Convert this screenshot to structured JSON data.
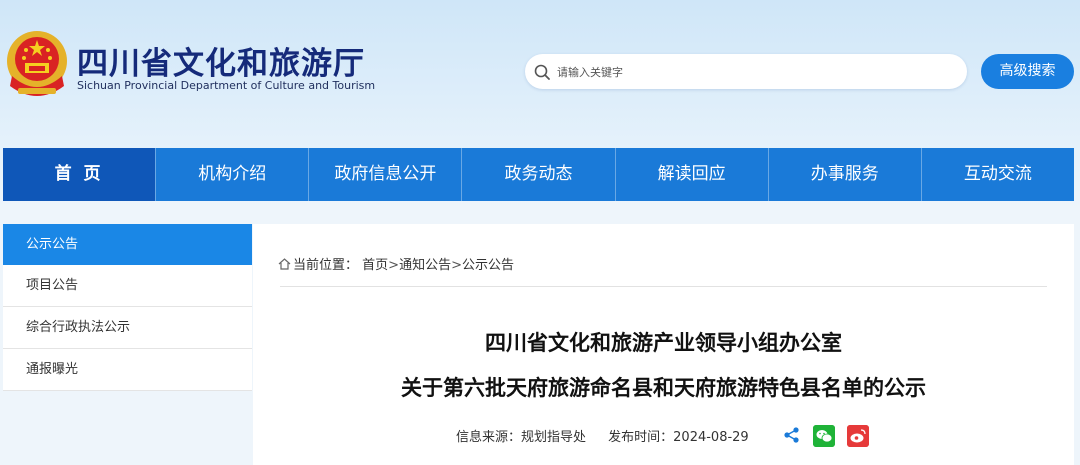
{
  "header": {
    "title": "四川省文化和旅游厅",
    "subtitle": "Sichuan Provincial Department of Culture and Tourism",
    "emblem_icon": "national-emblem-icon"
  },
  "search": {
    "placeholder": "请输入关键字",
    "value": "",
    "advanced_label": "高级搜索"
  },
  "nav": {
    "items": [
      {
        "label": "首 页"
      },
      {
        "label": "机构介绍"
      },
      {
        "label": "政府信息公开"
      },
      {
        "label": "政务动态"
      },
      {
        "label": "解读回应"
      },
      {
        "label": "办事服务"
      },
      {
        "label": "互动交流"
      }
    ]
  },
  "sidebar": {
    "items": [
      {
        "label": "公示公告"
      },
      {
        "label": "项目公告"
      },
      {
        "label": "综合行政执法公示"
      },
      {
        "label": "通报曝光"
      }
    ]
  },
  "breadcrumb": {
    "prefix": "当前位置：",
    "items": [
      "首页",
      "通知公告",
      "公示公告"
    ],
    "separator": ">"
  },
  "article": {
    "title_line1": "四川省文化和旅游产业领导小组办公室",
    "title_line2": "关于第六批天府旅游命名县和天府旅游特色县名单的公示",
    "source": "信息来源：规划指导处",
    "date_label": "发布时间：2024-08-29"
  },
  "colors": {
    "nav_bg": "#1a7ad8",
    "nav_active": "#0f57b8",
    "sidebar_active": "#1a87e6",
    "title_color": "#152a7a",
    "wechat": "#1fb338",
    "weibo": "#e63a3a"
  }
}
